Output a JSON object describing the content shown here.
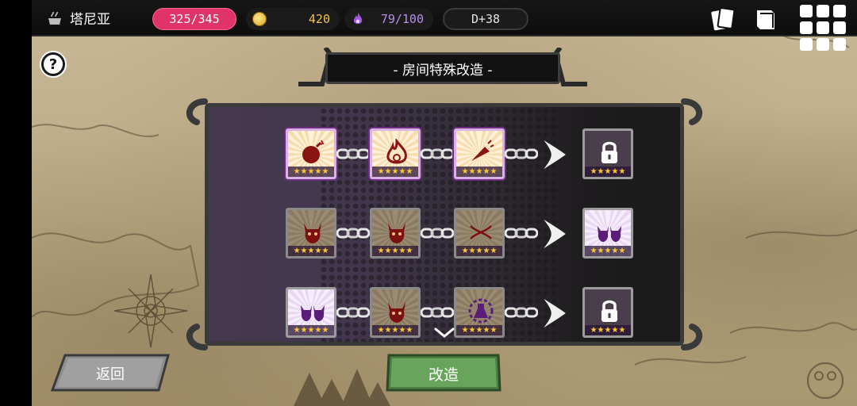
{
  "topbar": {
    "location_label": "塔尼亚",
    "hp": "325/345",
    "gold": "420",
    "mana": "79/100",
    "day": "D+38"
  },
  "icons": {
    "location": "cauldron-icon",
    "gold": "coin-icon",
    "mana": "purple-flame-icon",
    "cards": "cards-icon",
    "book": "book-icon",
    "menu": "grid-menu-icon",
    "help": "help-icon"
  },
  "help_label": "?",
  "title": "- 房间特殊改造 -",
  "colors": {
    "hp_pill": "#e0336a",
    "gold_text": "#f2c24a",
    "mana_text": "#b88ee6",
    "tile_active_border": "#d9b0e8",
    "star": "#ffc83a",
    "reform_button": "#5e9a52"
  },
  "rows": [
    {
      "tiles": [
        {
          "icon": "bomb-icon",
          "state": "active",
          "stars": 5
        },
        {
          "icon": "flame-swirl-icon",
          "state": "active",
          "stars": 5
        },
        {
          "icon": "horn-icon",
          "state": "active",
          "stars": 5
        }
      ],
      "result": {
        "icon": "lock-icon",
        "state": "locked",
        "stars": 5
      }
    },
    {
      "tiles": [
        {
          "icon": "demon-icon",
          "state": "dim",
          "stars": 5
        },
        {
          "icon": "demon-icon",
          "state": "dim",
          "stars": 5
        },
        {
          "icon": "dna-icon",
          "state": "dim",
          "stars": 5
        }
      ],
      "result": {
        "icon": "twin-demon-icon",
        "state": "lavender",
        "stars": 5
      }
    },
    {
      "tiles": [
        {
          "icon": "twin-demon-icon",
          "state": "lavender",
          "stars": 5
        },
        {
          "icon": "demon-icon",
          "state": "dim",
          "stars": 5
        },
        {
          "icon": "flask-gear-icon",
          "state": "dim",
          "stars": 5
        }
      ],
      "result": {
        "icon": "lock-icon",
        "state": "locked",
        "stars": 5
      }
    }
  ],
  "star_glyph": "★★★★★",
  "buttons": {
    "back": "返回",
    "reform": "改造"
  }
}
